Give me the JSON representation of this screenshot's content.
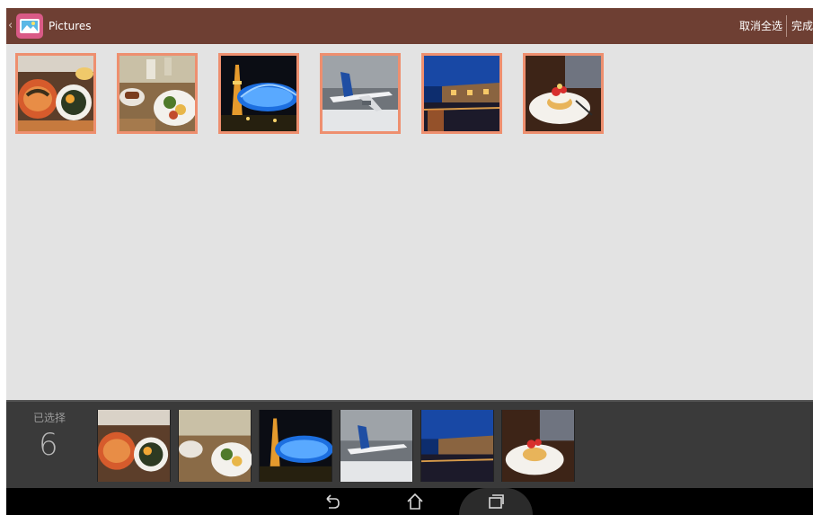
{
  "action_bar": {
    "back_glyph": "‹",
    "title": "Pictures",
    "deselect_all_label": "取消全选",
    "done_label": "完成",
    "color": "#6e3f33"
  },
  "grid": {
    "items": [
      {
        "name": "food-bowls-photo",
        "selected": true
      },
      {
        "name": "breakfast-plate-photo",
        "selected": true
      },
      {
        "name": "night-tower-photo",
        "selected": true
      },
      {
        "name": "airplane-photo",
        "selected": true
      },
      {
        "name": "canal-warehouse-night-photo",
        "selected": true
      },
      {
        "name": "strawberry-dessert-photo",
        "selected": true
      }
    ],
    "selection_border_color": "#ee8f6f"
  },
  "tray": {
    "selected_label": "已选择",
    "selected_count": "6"
  },
  "nav": {
    "buttons": [
      "back-icon",
      "home-icon",
      "recents-icon"
    ]
  }
}
